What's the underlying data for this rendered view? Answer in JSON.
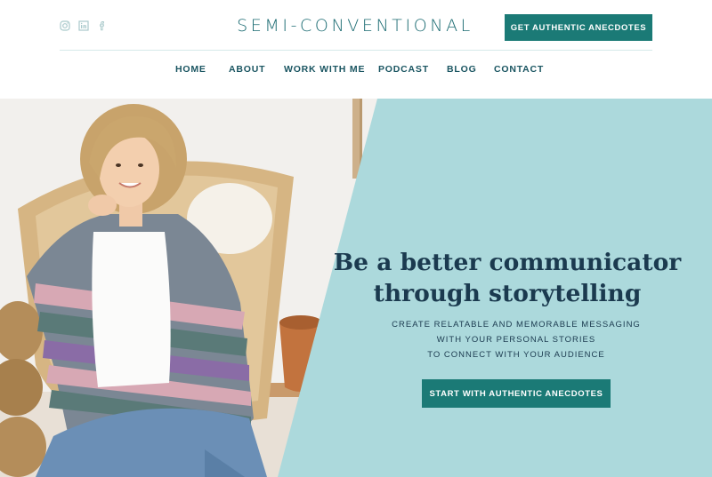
{
  "brand": {
    "logo_text": "SEMI-CONVENTIONAL",
    "colors": {
      "accent": "#1b7a76",
      "heading": "#1b3a4f",
      "panel": "#acd9dc",
      "logo": "#1b6b72"
    }
  },
  "social": [
    {
      "icon": "instagram-icon"
    },
    {
      "icon": "linkedin-icon"
    },
    {
      "icon": "facebook-icon"
    }
  ],
  "header": {
    "cta_label": "GET AUTHENTIC ANECDOTES"
  },
  "nav": {
    "items": [
      {
        "label": "HOME"
      },
      {
        "label": "ABOUT"
      },
      {
        "label": "WORK WITH ME"
      },
      {
        "label": "PODCAST"
      },
      {
        "label": "BLOG"
      },
      {
        "label": "CONTACT"
      }
    ]
  },
  "hero": {
    "headline": [
      "Be a better communicator",
      "through storytelling"
    ],
    "subtext": [
      "CREATE RELATABLE AND MEMORABLE MESSAGING",
      "WITH YOUR PERSONAL STORIES",
      "TO CONNECT WITH YOUR AUDIENCE"
    ],
    "cta_label": "START WITH AUTHENTIC ANECDOTES"
  }
}
